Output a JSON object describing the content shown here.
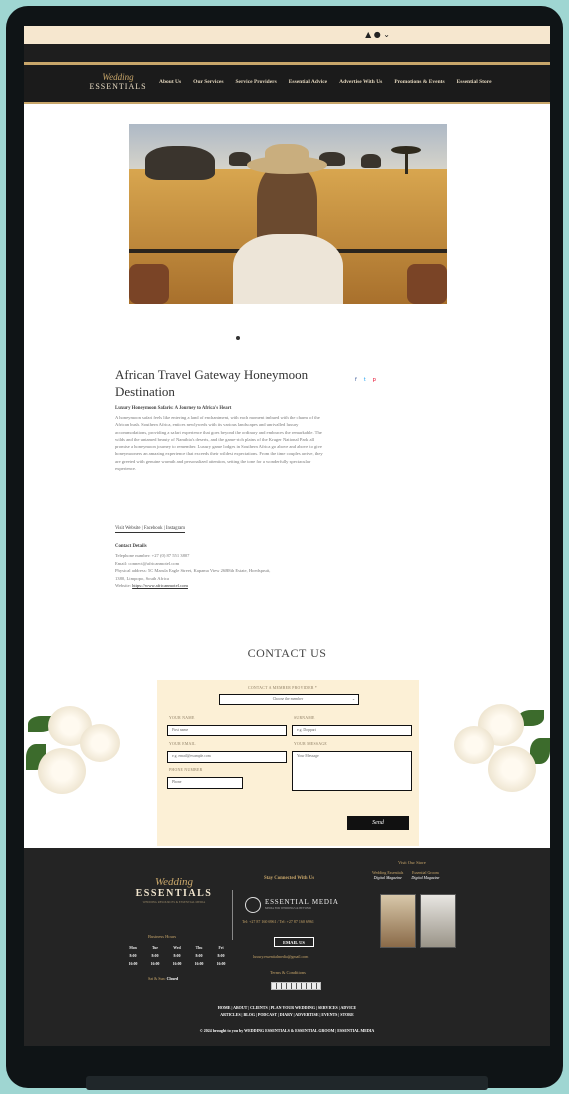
{
  "topbar": {
    "icons": "▲ ● ⌄"
  },
  "nav": {
    "logo_script": "Wedding",
    "logo_big": "ESSENTIALS",
    "links": [
      "About Us",
      "Our Services",
      "Service Providers",
      "Essential Advice",
      "Advertise With Us",
      "Promotions & Events",
      "Essential Store"
    ]
  },
  "article": {
    "title": "African Travel Gateway Honeymoon Destination",
    "social": [
      "f",
      "t",
      "p"
    ],
    "lead": "Luxury Honeymoon Safaris: A Journey to Africa's Heart",
    "body": "A honeymoon safari feels like entering a land of enchantment, with each moment imbued with the charm of the African bush. Southern Africa, entices newlyweds with its various landscapes and unrivalled luxury accommodations, providing a safari experience that goes beyond the ordinary and embraces the remarkable. The wilds and the untamed beauty of Namibia's deserts, and the game-rich plains of the Kruger National Park all promise a honeymoon journey to remember. Luxury game lodges in Southern Africa go above and above to give honeymooners an amazing experience that exceeds their wildest expectations. From the time couples arrive, they are greeted with genuine warmth and personalized attention, setting the tone for a wonderfully spectacular experience.",
    "links": "Visit Website | Facebook | Instagram",
    "contact_head": "Contact Details",
    "contact_lines": [
      "Telephone number: +27 (0) 87 551 3807",
      "Email: connect@africanmotel.com",
      "Physical address: 5C Marula Eagle Street, Kapama View 26B8th Estate, Hoedspruit,",
      "1380, Limpopo, South Africa"
    ],
    "website_prefix": "Website: ",
    "website": "https://www.africanmotel.com"
  },
  "contact": {
    "title": "CONTACT US",
    "member_label": "CONTACT A MEMBER PROVIDER *",
    "member_placeholder": "Choose the member",
    "first_label": "YOUR NAME",
    "first_placeholder": "First name",
    "surname_label": "SURNAME",
    "surname_placeholder": "e.g. Doppari",
    "email_label": "YOUR EMAIL",
    "email_placeholder": "e.g. email@example.com",
    "message_label": "YOUR MESSAGE",
    "message_placeholder": "Your Message",
    "phone_label": "PHONE NUMBER",
    "phone_placeholder": "Phone",
    "send": "Send"
  },
  "footer": {
    "logo_script": "Wedding",
    "logo_big": "ESSENTIALS",
    "logo_sub": "WEDDING RESOURCES & ESSENTIAL MEDIA",
    "hours_title": "Business Hours",
    "hours": [
      [
        "Mon",
        "Tue",
        "Wed",
        "Thu",
        "Fri"
      ],
      [
        "8:00",
        "8:00",
        "8:00",
        "8:00",
        "8:00"
      ],
      [
        "16:00",
        "16:00",
        "16:00",
        "16:00",
        "16:00"
      ]
    ],
    "closed_label": "Sat & Sun:",
    "closed_value": "Closed",
    "stay": "Stay Connected With Us",
    "media_name": "ESSENTIAL MEDIA",
    "media_tag": "MEDIA FOR WEDDINGS & BEYOND",
    "phones": "Tel: +27 87 160 6961 / Tel: +27 87 160 6961",
    "email_button": "EMAIL US",
    "email_addr": "luxury.essentialmedia@gmail.com",
    "terms": "Terms & Conditions",
    "store_title": "Visit Our Store",
    "store_items": [
      {
        "title": "Wedding Essentials",
        "sub": "Digital Magazine"
      },
      {
        "title": "Essential Groom",
        "sub": "Digital Magazine"
      }
    ],
    "fnav1": "HOME | ABOUT | CLIENTS | PLAN YOUR WEDDING | SERVICES | ADVICE",
    "fnav2": "ARTICLES | BLOG | PODCAST | DIARY | ADVERTISE | EVENTS | STORE",
    "copyright": "© 2024 brought to you by WEDDING ESSENTIALS & ESSENTIAL GROOM | ESSENTIAL MEDIA"
  }
}
